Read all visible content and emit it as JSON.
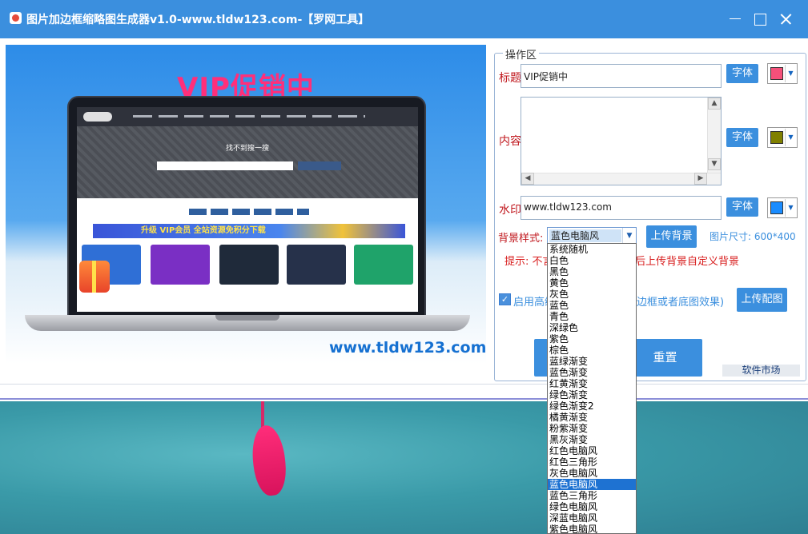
{
  "window": {
    "title": "图片加边框缩略图生成器v1.0-www.tldw123.com-【罗网工具】"
  },
  "preview": {
    "title": "VIP促销中",
    "watermark": "www.tldw123.com",
    "hero_text": "找不到搜一搜",
    "banner_text": "升级 VIP会员  全站资源免积分下载"
  },
  "panel": {
    "legend": "操作区",
    "title_label": "标题",
    "title_value": "VIP促销中",
    "content_label": "内容",
    "content_value": "",
    "watermark_label": "水印",
    "watermark_value": "www.tldw123.com",
    "font_button": "字体",
    "bg_label": "背景样式:",
    "bg_selected": "蓝色电脑风",
    "upload_bg_button": "上传背景",
    "size_label": "图片尺寸: 600*400",
    "hint_left": "提示: 不言",
    "hint_right": "后上传背景自定义背景",
    "checkbox_label": "启用高级",
    "checkbox_suffix": "边框或者底图效果)",
    "upload_decor_button": "上传配图",
    "reset_button": "重置",
    "market_label": "软件市场"
  },
  "colors": {
    "title_color": "#f5507a",
    "content_color": "#808000",
    "watermark_color": "#1a8cff",
    "accent": "#3b8fde"
  },
  "dropdown": {
    "options": [
      "系统随机",
      "白色",
      "黑色",
      "黄色",
      "灰色",
      "蓝色",
      "青色",
      "深绿色",
      "紫色",
      "棕色",
      "蓝绿渐变",
      "蓝色渐变",
      "红黄渐变",
      "绿色渐变",
      "绿色渐变2",
      "橘黄渐变",
      "粉紫渐变",
      "黑灰渐变",
      "红色电脑风",
      "红色三角形",
      "灰色电脑风",
      "蓝色电脑风",
      "蓝色三角形",
      "绿色电脑风",
      "深蓝电脑风",
      "紫色电脑风"
    ],
    "selected_index": 21
  }
}
